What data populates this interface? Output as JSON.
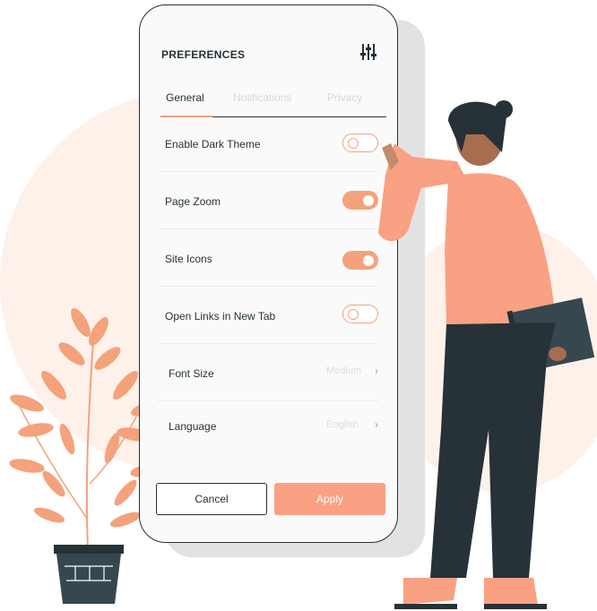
{
  "header": {
    "title": "PREFERENCES",
    "filter_icon": "sliders-icon"
  },
  "tabs": [
    {
      "label": "General",
      "active": true
    },
    {
      "label": "Notifications",
      "active": false
    },
    {
      "label": "Privacy",
      "active": false
    }
  ],
  "settings": [
    {
      "label": "Enable Dark Theme",
      "type": "toggle",
      "on": false
    },
    {
      "label": "Page Zoom",
      "type": "toggle",
      "on": true
    },
    {
      "label": "Site Icons",
      "type": "toggle",
      "on": true
    },
    {
      "label": "Open Links in New Tab",
      "type": "toggle",
      "on": false
    },
    {
      "label": "Font Size",
      "type": "select",
      "value": "Medium"
    },
    {
      "label": "Language",
      "type": "select",
      "value": "English"
    }
  ],
  "buttons": {
    "cancel": "Cancel",
    "apply": "Apply"
  },
  "colors": {
    "accent": "#f4a27c",
    "dark": "#263238",
    "background_blob": "#fdf1ea"
  }
}
